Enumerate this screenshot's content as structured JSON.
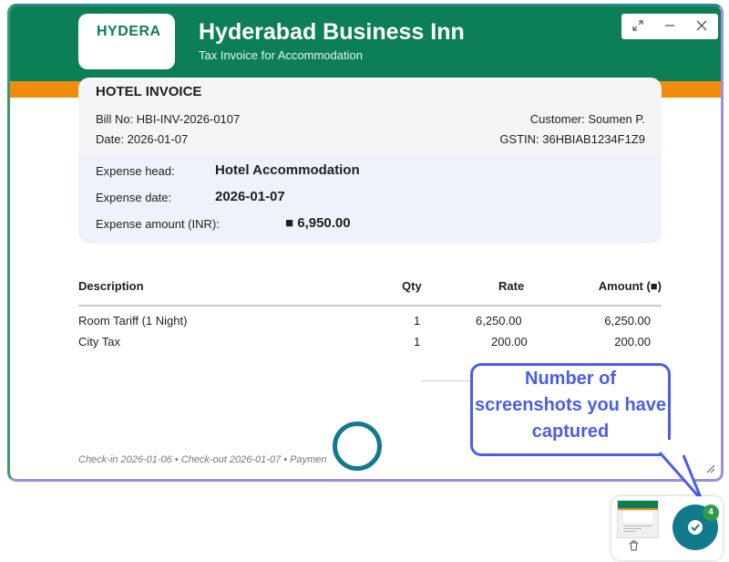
{
  "header": {
    "logo_text": "HYDERA",
    "hotel_name": "Hyderabad Business Inn",
    "subtitle": "Tax Invoice for Accommodation"
  },
  "window_controls": {
    "expand_icon": "expand-icon",
    "minimize_icon": "minimize-icon",
    "close_icon": "close-icon"
  },
  "invoice": {
    "title": "HOTEL INVOICE",
    "bill_no": "Bill No: HBI-INV-2026-0107",
    "date": "Date: 2026-01-07",
    "customer": "Customer: Soumen P.",
    "gstin": "GSTIN: 36HBIAB1234F1Z9"
  },
  "expense": {
    "head_label": "Expense head:",
    "head_value": "Hotel Accommodation",
    "date_label": "Expense date:",
    "date_value": "2026-01-07",
    "amount_label": "Expense amount (INR):",
    "amount_value": "■ 6,950.00"
  },
  "table": {
    "headers": [
      "Description",
      "Qty",
      "Rate",
      "Amount (■)"
    ],
    "rows": [
      [
        "Room Tariff (1 Night)",
        "1",
        "6,250.00",
        "6,250.00"
      ],
      [
        "City Tax",
        "1",
        "200.00",
        "200.00"
      ]
    ]
  },
  "footer_note": "Check-in 2026-01-06 • Check-out 2026-01-07 • Paymen",
  "callout": {
    "line1": "Number of",
    "line2": "screenshots you have",
    "line3": "captured"
  },
  "screenshot_counter": {
    "count": "4"
  },
  "colors": {
    "header_green": "#0c7f57",
    "accent_orange": "#f28c0f",
    "callout_blue": "#4a5ee8",
    "button_teal": "#137a8e"
  }
}
